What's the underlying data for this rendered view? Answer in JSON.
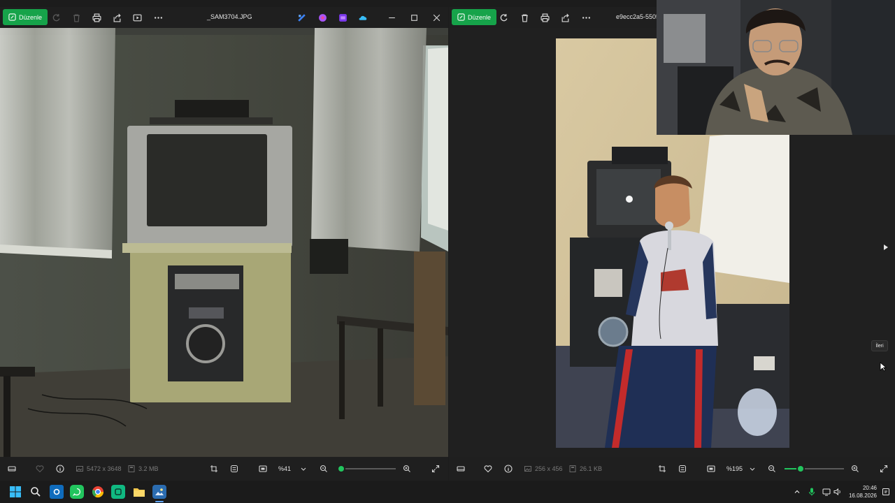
{
  "left_window": {
    "edit_label": "Düzenle",
    "title": "_SAM3704.JPG",
    "dimensions": "5472 x 3648",
    "file_size": "3.2 MB",
    "zoom": "%41",
    "zoom_level": 0.07
  },
  "right_window": {
    "edit_label": "Düzenle",
    "title": "e9ecc2a5-5505",
    "dimensions": "256 x 456",
    "file_size": "26.1 KB",
    "zoom": "%195",
    "zoom_level": 0.27,
    "tooltip": "İleri"
  },
  "taskbar": {
    "time": "20:46",
    "date": "16.08.2026"
  },
  "colors": {
    "accent": "#16a34a",
    "slider": "#22c55e",
    "background": "#202020"
  }
}
